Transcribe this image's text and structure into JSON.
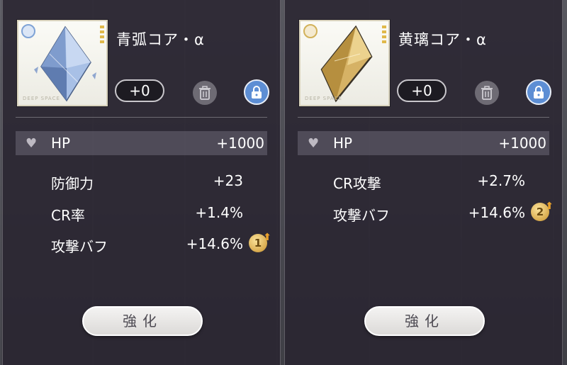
{
  "cards": [
    {
      "name": "青弧コア・α",
      "level": "+0",
      "thumb_caption": "DEEP SPACE",
      "stats": [
        {
          "label": "HP",
          "value": "+1000"
        },
        {
          "label": "防御力",
          "value": "+23"
        },
        {
          "label": "CR率",
          "value": "+1.4%"
        },
        {
          "label": "攻撃バフ",
          "value": "+14.6%",
          "badge": "1"
        }
      ],
      "enhance_label": "強化",
      "gem_color": "#9fb8e0"
    },
    {
      "name": "黄璃コア・α",
      "level": "+0",
      "thumb_caption": "DEEP SPACE",
      "stats": [
        {
          "label": "HP",
          "value": "+1000"
        },
        {
          "label": "CR攻撃",
          "value": "+2.7%"
        },
        {
          "label": "攻撃バフ",
          "value": "+14.6%",
          "badge": "2"
        }
      ],
      "enhance_label": "強化",
      "gem_color": "#d9b25a"
    }
  ],
  "icons": {
    "trash": "trash-icon",
    "lock": "lock-icon",
    "heart": "heart-icon"
  }
}
